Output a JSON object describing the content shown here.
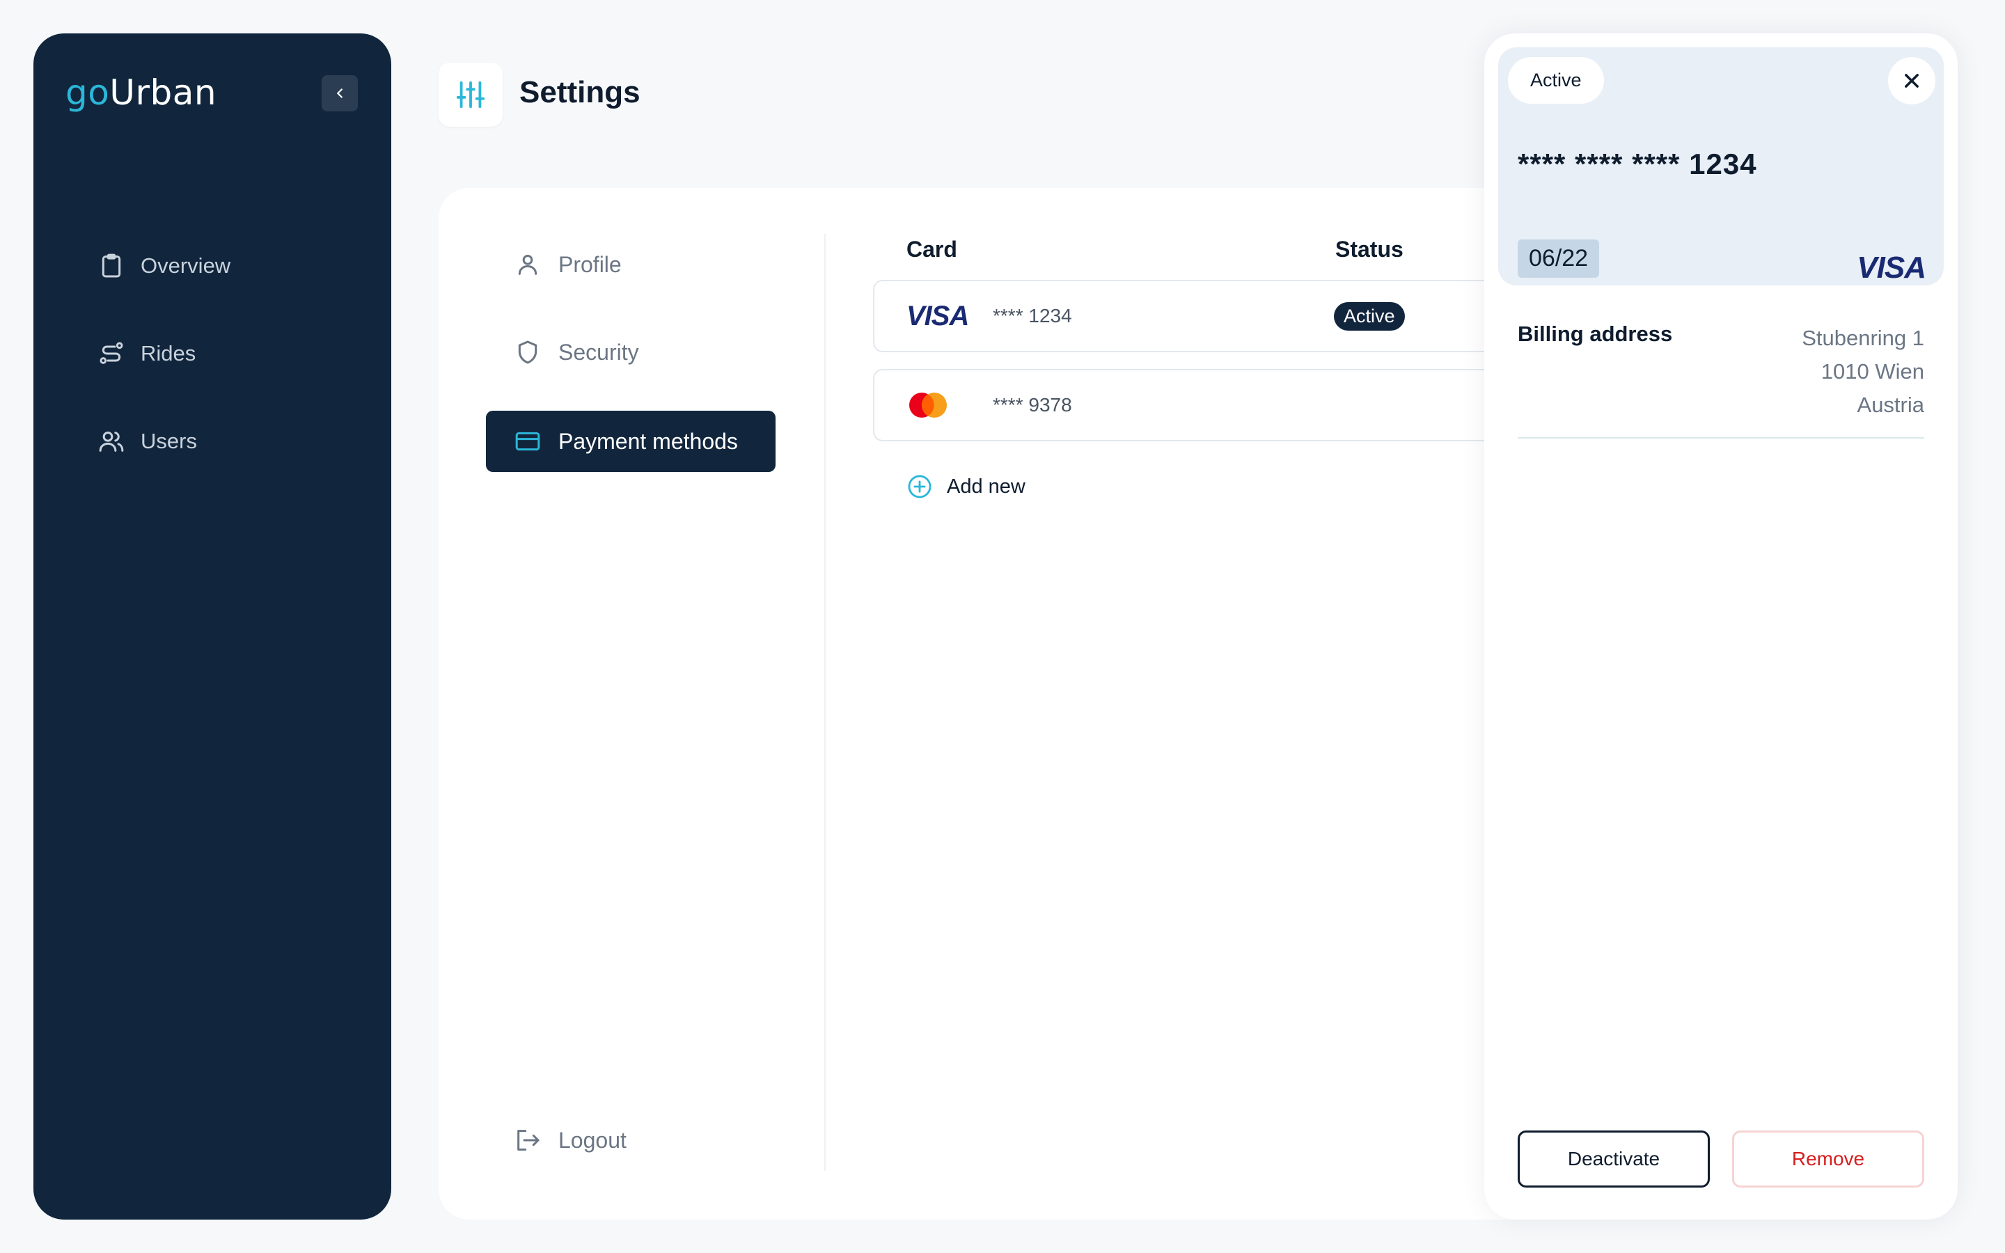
{
  "app": {
    "logo_go": "go",
    "logo_rest": "Urban"
  },
  "sidebar": {
    "items": [
      {
        "label": "Overview",
        "icon": "clipboard-icon"
      },
      {
        "label": "Rides",
        "icon": "route-icon"
      },
      {
        "label": "Users",
        "icon": "users-icon"
      }
    ]
  },
  "header": {
    "title": "Settings",
    "icon": "sliders-icon"
  },
  "settings_menu": {
    "items": [
      {
        "label": "Profile",
        "icon": "user-icon"
      },
      {
        "label": "Security",
        "icon": "shield-icon"
      },
      {
        "label": "Payment methods",
        "icon": "credit-card-icon",
        "active": true
      }
    ],
    "logout_label": "Logout"
  },
  "cards_table": {
    "columns": [
      "Card",
      "Status"
    ],
    "rows": [
      {
        "brand": "VISA",
        "number": "**** 1234",
        "status": "Active"
      },
      {
        "brand": "mastercard",
        "number": "**** 9378",
        "status": ""
      }
    ],
    "add_new_label": "Add new"
  },
  "card_detail": {
    "status": "Active",
    "number": "**** **** **** 1234",
    "expiry": "06/22",
    "brand": "VISA",
    "billing_label": "Billing address",
    "billing_lines": [
      "Stubenring 1",
      "1010 Wien",
      "Austria"
    ],
    "deactivate_label": "Deactivate",
    "remove_label": "Remove"
  },
  "colors": {
    "navy": "#11263d",
    "accent": "#2bb7d9",
    "danger": "#d61e1e"
  }
}
